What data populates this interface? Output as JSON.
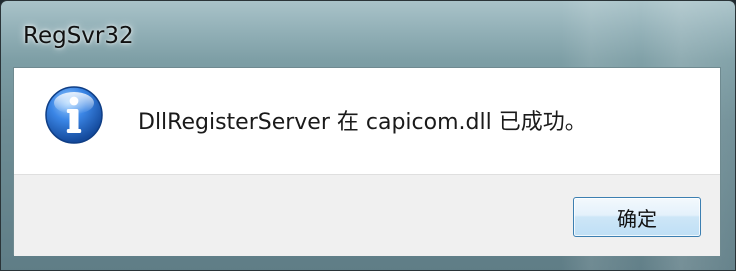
{
  "window": {
    "title": "RegSvr32"
  },
  "dialog": {
    "icon": "info-icon",
    "message": "DllRegisterServer 在 capicom.dll 已成功。",
    "ok_label": "确定"
  },
  "colors": {
    "dialog_background": "#ffffff",
    "footer_background": "#f0f0f0",
    "button_border": "#3c7fb1",
    "icon_blue": "#1f5fb8"
  }
}
